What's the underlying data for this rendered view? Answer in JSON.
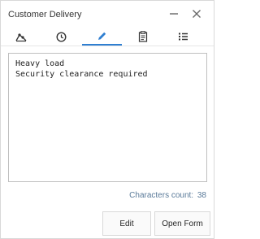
{
  "header": {
    "title": "Customer Delivery",
    "minimize_icon": "minimize-icon",
    "close_icon": "close-icon"
  },
  "tabs": [
    {
      "icon": "route-icon",
      "active": false
    },
    {
      "icon": "clock-icon",
      "active": false
    },
    {
      "icon": "pencil-icon",
      "active": true
    },
    {
      "icon": "document-icon",
      "active": false
    },
    {
      "icon": "list-icon",
      "active": false
    }
  ],
  "notes": {
    "text": "Heavy load\nSecurity clearance required"
  },
  "counter": {
    "label": "Characters count:",
    "value": "38"
  },
  "buttons": {
    "edit_label": "Edit",
    "open_form_label": "Open Form"
  },
  "colors": {
    "accent": "#2f7fd1",
    "counter_text": "#5a7a99",
    "border": "#d9d9d9"
  }
}
